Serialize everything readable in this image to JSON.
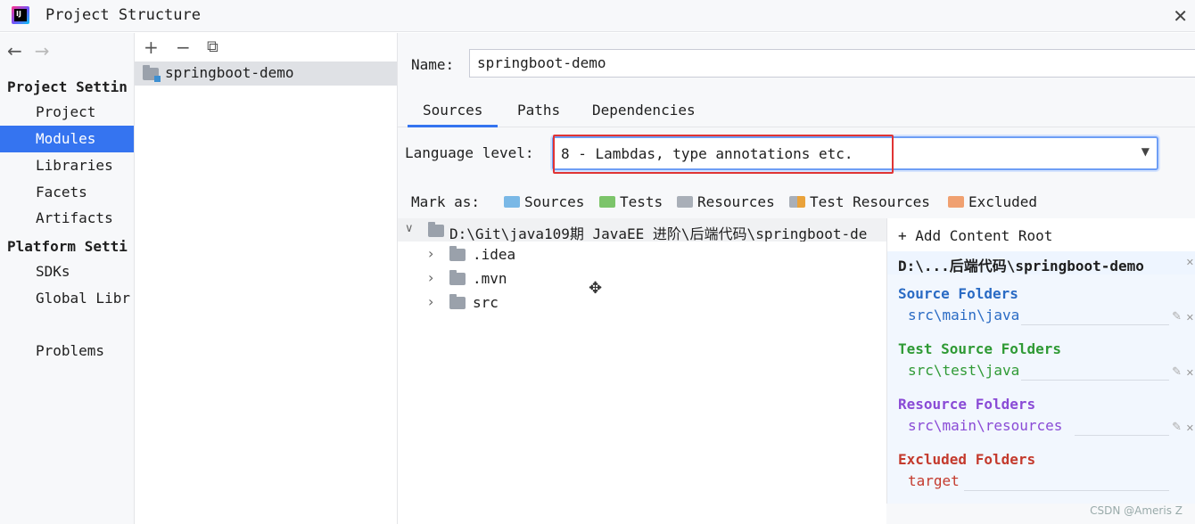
{
  "window": {
    "title": "Project Structure",
    "close_glyph": "✕",
    "icon_label": "IJ"
  },
  "nav": {
    "back_glyph": "←",
    "forward_glyph": "→",
    "project_settings_header": "Project Settin",
    "platform_settings_header": "Platform Setti",
    "items": {
      "project": "Project",
      "modules": "Modules",
      "libraries": "Libraries",
      "facets": "Facets",
      "artifacts": "Artifacts",
      "sdks": "SDKs",
      "global_libraries": "Global Libr",
      "problems": "Problems"
    }
  },
  "modules_toolbar": {
    "add": "+",
    "remove": "−",
    "copy": "⧉"
  },
  "module": {
    "name": "springboot-demo"
  },
  "detail": {
    "name_label": "Name:",
    "name_value": "springboot-demo",
    "tabs": {
      "sources": "Sources",
      "paths": "Paths",
      "dependencies": "Dependencies"
    },
    "language_level_label": "Language level:",
    "language_level_value": "8 - Lambdas, type annotations etc.",
    "mark_as_label": "Mark as:",
    "mark_as": {
      "sources": "Sources",
      "tests": "Tests",
      "resources": "Resources",
      "test_resources": "Test Resources",
      "excluded": "Excluded"
    }
  },
  "tree": {
    "root": "D:\\Git\\java109期 JavaEE 进阶\\后端代码\\springboot-de",
    "children": [
      ".idea",
      ".mvn",
      "src"
    ],
    "expanded_glyph": "∨",
    "collapsed_glyph": "›"
  },
  "content_root": {
    "add_label": "+ Add Content Root",
    "path": "D:\\...后端代码\\springboot-demo",
    "source_title": "Source Folders",
    "source_path": "src\\main\\java",
    "test_title": "Test Source Folders",
    "test_path": "src\\test\\java",
    "resource_title": "Resource Folders",
    "resource_path": "src\\main\\resources",
    "excluded_title": "Excluded Folders",
    "excluded_path": "target"
  },
  "colors": {
    "accent": "#3574f0",
    "source": "#2a6bc4",
    "test": "#2f9a35",
    "resource": "#8a4bd6",
    "excluded": "#c43a2d",
    "highlight_box": "#e03434"
  },
  "watermark": "CSDN @Ameris Z"
}
